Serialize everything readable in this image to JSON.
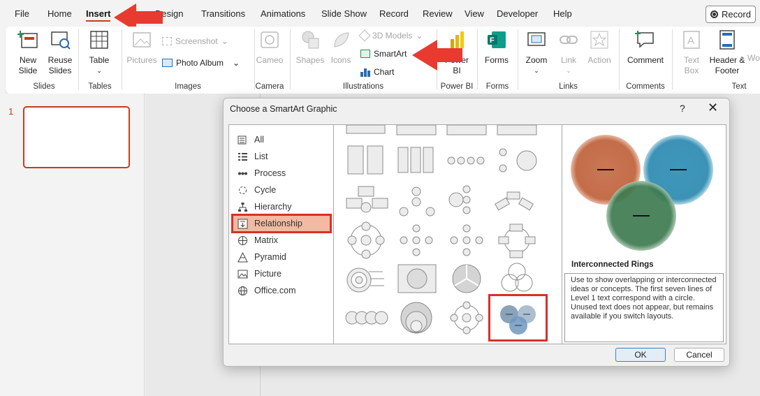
{
  "tabs": [
    "File",
    "Home",
    "Insert",
    "Design",
    "Transitions",
    "Animations",
    "Slide Show",
    "Record",
    "Review",
    "View",
    "Developer",
    "Help"
  ],
  "record_button": "Record",
  "ribbon": {
    "new_slide": "New Slide",
    "reuse_slides": "Reuse Slides",
    "table": "Table",
    "pictures": "Pictures",
    "screenshot": "Screenshot",
    "photo_album": "Photo Album",
    "cameo": "Cameo",
    "shapes": "Shapes",
    "icons": "Icons",
    "models_3d": "3D Models",
    "smartart": "SmartArt",
    "chart": "Chart",
    "power_bi": "Power BI",
    "forms": "Forms",
    "zoom": "Zoom",
    "link": "Link",
    "action": "Action",
    "comment": "Comment",
    "text_box": "Text Box",
    "header_footer": "Header & Footer",
    "wordart_partial": "Wo",
    "groups": [
      "Slides",
      "Tables",
      "Images",
      "Camera",
      "Illustrations",
      "Power BI",
      "Forms",
      "Links",
      "Comments",
      "Text"
    ]
  },
  "slide_panel": {
    "slide_number": "1"
  },
  "dialog": {
    "title": "Choose a SmartArt Graphic",
    "help": "?",
    "close": "✕",
    "categories": [
      "All",
      "List",
      "Process",
      "Cycle",
      "Hierarchy",
      "Relationship",
      "Matrix",
      "Pyramid",
      "Picture",
      "Office.com"
    ],
    "selected_category": "Relationship",
    "preview_name": "Interconnected Rings",
    "preview_description": "Use to show overlapping or interconnected ideas or concepts. The first seven lines of Level 1 text correspond with a circle. Unused text does not appear, but remains available if you switch layouts.",
    "ok": "OK",
    "cancel": "Cancel"
  },
  "colors": {
    "accent": "#c43e1c",
    "highlight": "#d8302a",
    "selection": "#f3b9a2"
  }
}
